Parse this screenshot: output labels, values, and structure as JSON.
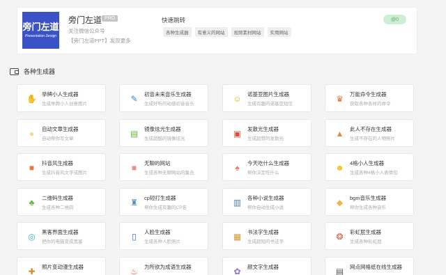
{
  "profile": {
    "logo_line1": "旁门左道",
    "logo_line2": "Presentation Design",
    "name": "旁门左道",
    "badge": "PRO",
    "desc": "关注微信公众号",
    "more": "【旁门左道PPT】发现更多",
    "quick_title": "快速跳转",
    "quick_tags": [
      "各种生成器",
      "有意义的网站",
      "视频素材网站",
      "实用网站"
    ],
    "count": "@0"
  },
  "section": {
    "title": "各种生成器"
  },
  "cards": [
    {
      "title": "举牌小人生成器",
      "desc": "生成举牌小人创意图片",
      "icon": "sign-person-icon",
      "glyph": "✋",
      "color": "#333"
    },
    {
      "title": "初音未来音乐生成器",
      "desc": "生成好听的动感初音音乐",
      "icon": "pen-icon",
      "glyph": "✎",
      "color": "#3a7bd5"
    },
    {
      "title": "诺基亚图片生成器",
      "desc": "生成有趣的诺基亚短信",
      "icon": "face-icon",
      "glyph": "☺",
      "color": "#e3b200"
    },
    {
      "title": "万能命令生成器",
      "desc": "获取各种各样的命令",
      "icon": "trophy-icon",
      "glyph": "♛",
      "color": "#e0762d"
    },
    {
      "title": "自动文章生成器",
      "desc": "自动帮你写文章",
      "icon": "chick-icon",
      "glyph": "●",
      "color": "#f1dc8a"
    },
    {
      "title": "镜像炫光生成器",
      "desc": "生成超酷的镜像炫光",
      "icon": "stack-icon",
      "glyph": "▤",
      "color": "#6bb34a"
    },
    {
      "title": "发散光生成器",
      "desc": "生成超赞的发散光",
      "icon": "gift-box-icon",
      "glyph": "▣",
      "color": "#d4553b"
    },
    {
      "title": "此人不存在生成器",
      "desc": "生成不存在的人物照片",
      "icon": "ring-stack-icon",
      "glyph": "▲",
      "color": "#d98b4a"
    },
    {
      "title": "抖音风生成器",
      "desc": "生成抖音风文字或图片",
      "icon": "cubes-icon",
      "glyph": "■",
      "color": "#e87a37"
    },
    {
      "title": "无聊的网站",
      "desc": "生成各种无聊网站的集合",
      "icon": "block-face-icon",
      "glyph": "■",
      "color": "#f08b8b"
    },
    {
      "title": "今天吃什么生成器",
      "desc": "帮你决定吃什么",
      "icon": "ice-cream-icon",
      "glyph": "♠",
      "color": "#e9836b"
    },
    {
      "title": "4格小人生成器",
      "desc": "生成各种4格小人表情包",
      "icon": "smile-icon",
      "glyph": "☻",
      "color": "#f2c41f"
    },
    {
      "title": "二维码生成器",
      "desc": "生成各种二维码",
      "icon": "qr-frog-icon",
      "glyph": "♣",
      "color": "#6ab548"
    },
    {
      "title": "cp短打生成器",
      "desc": "帮你生成有趣的CP名",
      "icon": "bottle-icon",
      "glyph": "♜",
      "color": "#4a8fb8"
    },
    {
      "title": "各种小说生成器",
      "desc": "帮你自动生成小说",
      "icon": "jar-icon",
      "glyph": "▥",
      "color": "#4d7ea8"
    },
    {
      "title": "bgm音乐生成器",
      "desc": "帮你生成各种音乐",
      "icon": "badge-icon",
      "glyph": "◆",
      "color": "#f0b54a"
    },
    {
      "title": "黑客界面生成器",
      "desc": "把你的电脑变成黑客",
      "icon": "snorkel-icon",
      "glyph": "◎",
      "color": "#3ab1c9"
    },
    {
      "title": "人脸生成器",
      "desc": "生成各种人脸照片",
      "icon": "phone-icon",
      "glyph": "▯",
      "color": "#3f6fb2"
    },
    {
      "title": "书法字生成器",
      "desc": "生成超短的书法字",
      "icon": "ink-box-icon",
      "glyph": "▦",
      "color": "#d69a3a"
    },
    {
      "title": "彩虹屁生成器",
      "desc": "生成各种彩虹屁",
      "icon": "egg-icon",
      "glyph": "❂",
      "color": "#d9573d"
    },
    {
      "title": "照片变动漫生成器",
      "desc": "",
      "icon": "key-icon",
      "glyph": "✚",
      "color": "#d98b2a"
    },
    {
      "title": "为所欲为成语生成器",
      "desc": "",
      "icon": "torch-icon",
      "glyph": "♨",
      "color": "#e2482d"
    },
    {
      "title": "颜文字生成器",
      "desc": "",
      "icon": "flower-icon",
      "glyph": "✿",
      "color": "#8a6fd1"
    },
    {
      "title": "网点网格纸在线生成器",
      "desc": "",
      "icon": "document-icon",
      "glyph": "▤",
      "color": "#555"
    }
  ]
}
